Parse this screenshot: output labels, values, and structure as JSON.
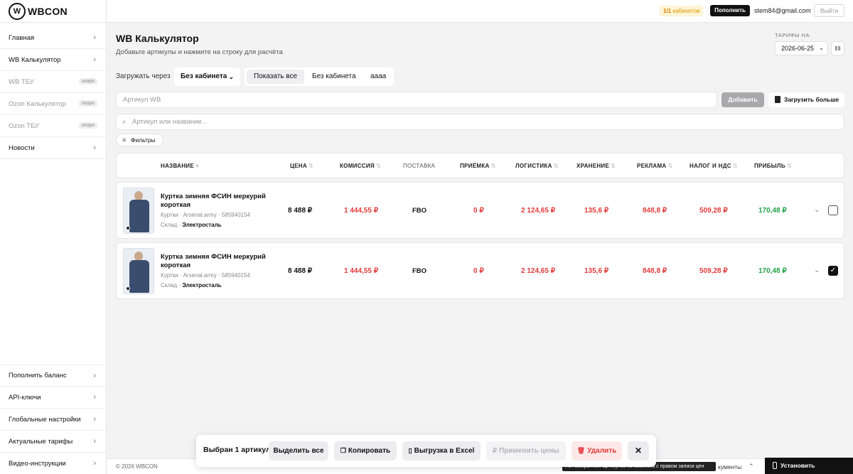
{
  "topbar": {
    "logo_mark": "W",
    "logo_text": "WBCON",
    "cabinets_count": "1/1",
    "cabinets_label": "кабинетов",
    "topup_label": "Пополнить",
    "user_email": "stem84@gmail.com",
    "logout_label": "Выйти"
  },
  "sidebar": {
    "items": [
      {
        "label": "Главная",
        "badge": ""
      },
      {
        "label": "WB Калькулятор",
        "badge": ""
      },
      {
        "label": "WB ТБУ",
        "badge": "скоро"
      },
      {
        "label": "Ozon Калькулятор",
        "badge": "скоро"
      },
      {
        "label": "Ozon ТБУ",
        "badge": "скоро"
      },
      {
        "label": "Новости",
        "badge": ""
      }
    ],
    "bottom_items": [
      {
        "label": "Пополнить баланс"
      },
      {
        "label": "API-ключи"
      },
      {
        "label": "Глобальные настройки"
      },
      {
        "label": "Актуальные тарифы"
      },
      {
        "label": "Видео-инструкции"
      }
    ]
  },
  "header": {
    "title": "WB Калькулятор",
    "subtitle": "Добавьте артикулы и нажмите на строку для расчёта",
    "tariffs_label": "ТАРИФЫ НА",
    "tariffs_date": "2026-06-25"
  },
  "load": {
    "label": "Загружать через",
    "cabinet_select": "Без кабинета",
    "options": [
      "Показать все",
      "Без кабинета",
      "аааа"
    ],
    "active_option": "Показать все"
  },
  "article_input": {
    "placeholder": "Артикул WB"
  },
  "add_label": "Добавить",
  "upload_more_label": "Загрузить больше",
  "search": {
    "placeholder": "Артикул или название..."
  },
  "filters_label": "Фильтры",
  "table": {
    "columns": [
      "НАЗВАНИЕ",
      "ЦЕНА",
      "КОМИССИЯ",
      "ПОСТАВКА",
      "ПРИЁМКА",
      "ЛОГИСТИКА",
      "ХРАНЕНИЕ",
      "РЕКЛАМА",
      "НАЛОГ И НДС",
      "ПРИБЫЛЬ"
    ],
    "rows": [
      {
        "name": "Куртка зимняя ФСИН меркурий короткая",
        "meta": "Куртки · Arsenal.army · 585940154",
        "warehouse_label": "Склад - ",
        "warehouse": "Электросталь",
        "price": "8 488 ₽",
        "commission": "1 444,55 ₽",
        "delivery": "FBO",
        "acceptance": "0 ₽",
        "logistics": "2 124,65 ₽",
        "storage": "135,6 ₽",
        "ads": "848,8 ₽",
        "tax": "509,28 ₽",
        "profit": "170,48 ₽",
        "checked": false
      },
      {
        "name": "Куртка зимняя ФСИН меркурий короткая",
        "meta": "Куртки · Arsenal.army · 585940154",
        "warehouse_label": "Склад - ",
        "warehouse": "Электросталь",
        "price": "8 488 ₽",
        "commission": "1 444,55 ₽",
        "delivery": "FBO",
        "acceptance": "0 ₽",
        "logistics": "2 124,65 ₽",
        "storage": "135,6 ₽",
        "ads": "848,8 ₽",
        "tax": "509,28 ₽",
        "profit": "170,48 ₽",
        "checked": true
      }
    ]
  },
  "action_bar": {
    "selected_label": "Выбран 1 артикул",
    "select_all": "Выделить все",
    "copy": "Копировать",
    "export": "Выгрузка в Excel",
    "apply_prices": "Применить цены",
    "delete": "Удалить"
  },
  "footer": {
    "copyright": "© 2026 WBCON",
    "docs": "кументы",
    "tooltip": "Нет выбранных артикулов из кабинета с правом записи цен",
    "install_app": "Установить приложение"
  },
  "colors": {
    "accent": "#111111",
    "negative": "#e23b3b",
    "positive": "#23a34a",
    "badge": "#d89a00"
  }
}
